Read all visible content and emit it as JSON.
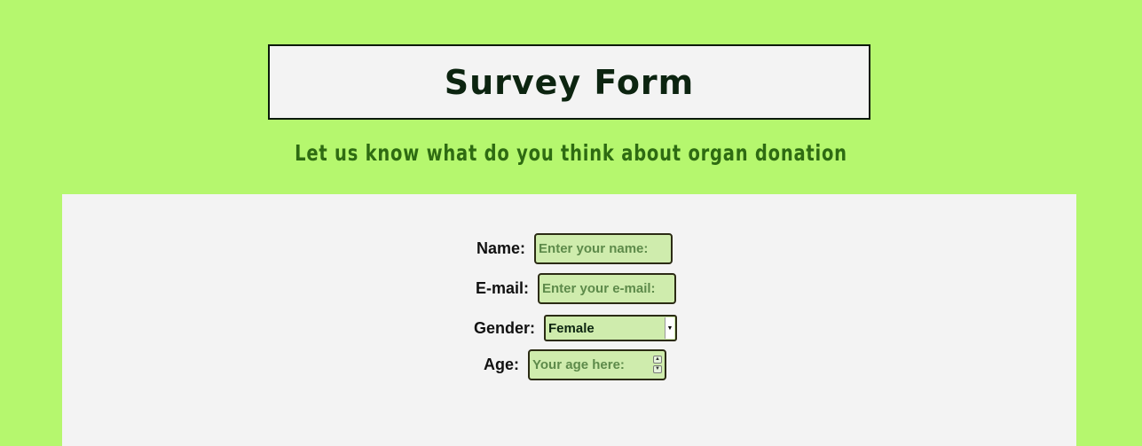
{
  "header": {
    "title": "Survey Form",
    "subtitle": "Let us know what do you think about organ donation"
  },
  "form": {
    "name": {
      "label": "Name:",
      "placeholder": "Enter your name:"
    },
    "email": {
      "label": "E-mail:",
      "placeholder": "Enter your e-mail:"
    },
    "gender": {
      "label": "Gender:",
      "selected": "Female",
      "options": [
        "Female"
      ]
    },
    "age": {
      "label": "Age:",
      "placeholder": "Your age here:"
    }
  },
  "colors": {
    "page_background": "#b5f76e",
    "panel_background": "#f3f3f3",
    "input_background": "#cfecad",
    "title_text": "#0c2410",
    "subtitle_text": "#2e6b12"
  },
  "icons": {
    "select_arrow": "chevron-down-icon",
    "spinner_up": "chevron-up-icon",
    "spinner_down": "chevron-down-icon"
  }
}
